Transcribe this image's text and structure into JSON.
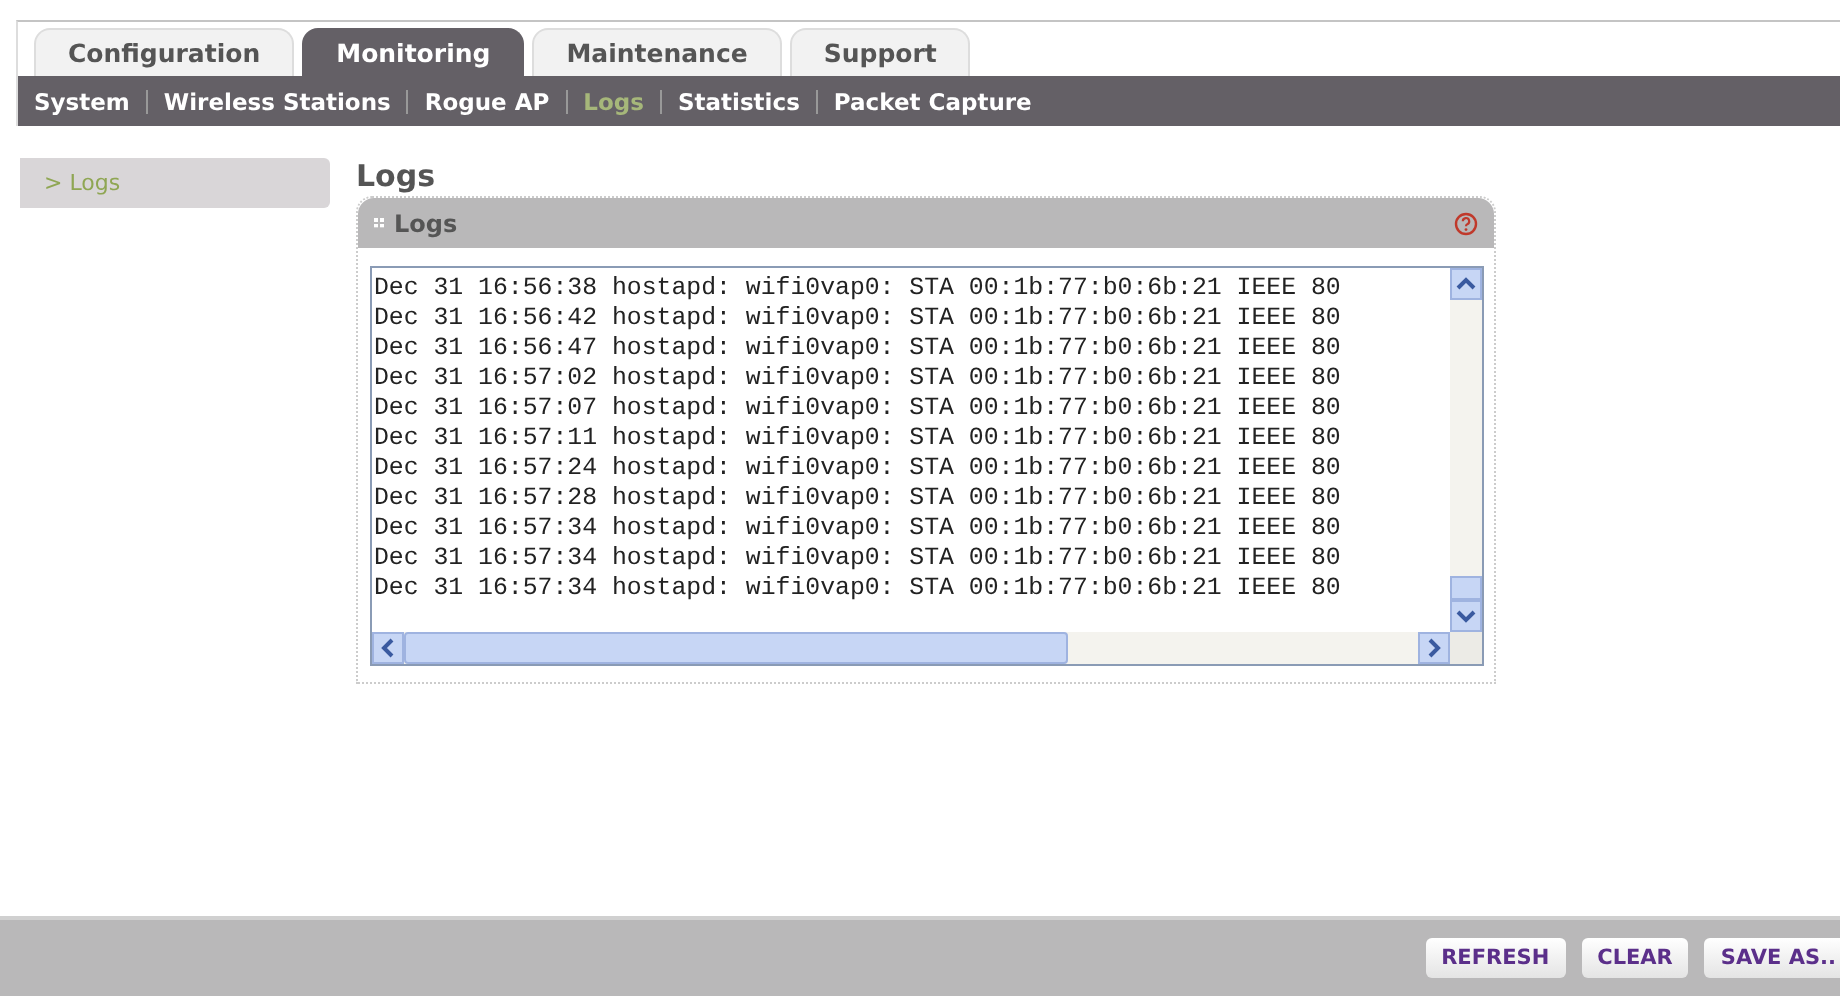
{
  "tabs": [
    {
      "label": "Configuration",
      "selected": false
    },
    {
      "label": "Monitoring",
      "selected": true
    },
    {
      "label": "Maintenance",
      "selected": false
    },
    {
      "label": "Support",
      "selected": false
    }
  ],
  "subnav": [
    {
      "label": "System",
      "selected": false
    },
    {
      "label": "Wireless Stations",
      "selected": false
    },
    {
      "label": "Rogue AP",
      "selected": false
    },
    {
      "label": "Logs",
      "selected": true
    },
    {
      "label": "Statistics",
      "selected": false
    },
    {
      "label": "Packet Capture",
      "selected": false
    }
  ],
  "sidebar": {
    "items": [
      {
        "label": "> Logs",
        "selected": true
      }
    ]
  },
  "page_title": "Logs",
  "panel": {
    "title": "Logs",
    "log_lines": [
      "Dec 31 16:56:38 hostapd: wifi0vap0: STA 00:1b:77:b0:6b:21 IEEE 80",
      "Dec 31 16:56:42 hostapd: wifi0vap0: STA 00:1b:77:b0:6b:21 IEEE 80",
      "Dec 31 16:56:47 hostapd: wifi0vap0: STA 00:1b:77:b0:6b:21 IEEE 80",
      "Dec 31 16:57:02 hostapd: wifi0vap0: STA 00:1b:77:b0:6b:21 IEEE 80",
      "Dec 31 16:57:07 hostapd: wifi0vap0: STA 00:1b:77:b0:6b:21 IEEE 80",
      "Dec 31 16:57:11 hostapd: wifi0vap0: STA 00:1b:77:b0:6b:21 IEEE 80",
      "Dec 31 16:57:24 hostapd: wifi0vap0: STA 00:1b:77:b0:6b:21 IEEE 80",
      "Dec 31 16:57:28 hostapd: wifi0vap0: STA 00:1b:77:b0:6b:21 IEEE 80",
      "Dec 31 16:57:34 hostapd: wifi0vap0: STA 00:1b:77:b0:6b:21 IEEE 80",
      "Dec 31 16:57:34 hostapd: wifi0vap0: STA 00:1b:77:b0:6b:21 IEEE 80",
      "Dec 31 16:57:34 hostapd: wifi0vap0: STA 00:1b:77:b0:6b:21 IEEE 80"
    ]
  },
  "buttons": [
    "REFRESH",
    "CLEAR",
    "SAVE AS.."
  ]
}
